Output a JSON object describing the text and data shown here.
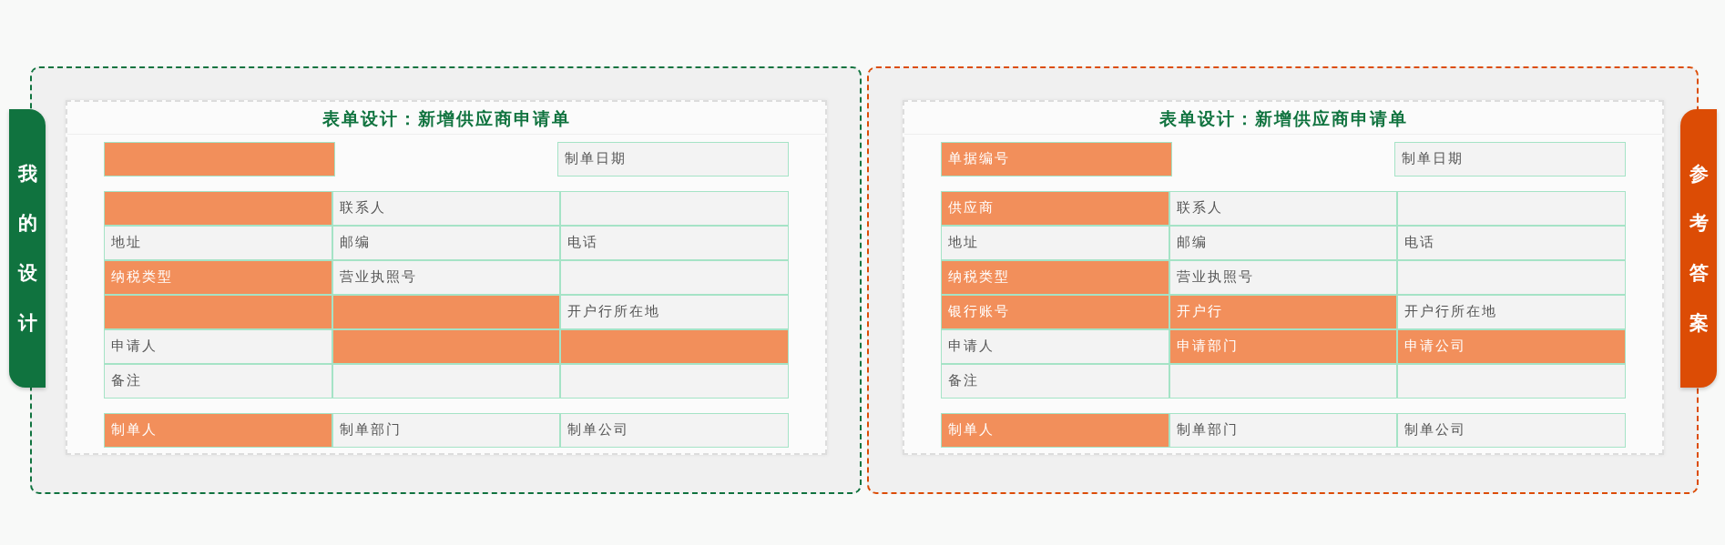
{
  "panels": [
    {
      "tab_label": "我的设计",
      "kind": "left",
      "color": "#10733f",
      "title": "表单设计：新增供应商申请单",
      "header": {
        "left": {
          "highlighted": true
        },
        "right": {
          "text": "制单日期",
          "highlighted": false
        }
      },
      "rows": [
        [
          {
            "highlighted": true
          },
          {
            "text": "联系人",
            "highlighted": false
          },
          {
            "highlighted": false
          }
        ],
        [
          {
            "text": "地址",
            "highlighted": false
          },
          {
            "text": "邮编",
            "highlighted": false
          },
          {
            "text": "电话",
            "highlighted": false
          }
        ],
        [
          {
            "text": "纳税类型",
            "highlighted": true
          },
          {
            "text": "营业执照号",
            "highlighted": false
          },
          {
            "highlighted": false
          }
        ],
        [
          {
            "highlighted": true
          },
          {
            "highlighted": true
          },
          {
            "text": "开户行所在地",
            "highlighted": false
          }
        ],
        [
          {
            "text": "申请人",
            "highlighted": false
          },
          {
            "highlighted": true
          },
          {
            "highlighted": true
          }
        ],
        [
          {
            "text": "备注",
            "highlighted": false
          },
          {
            "highlighted": false
          },
          {
            "highlighted": false
          }
        ]
      ],
      "footer": [
        {
          "text": "制单人",
          "highlighted": true
        },
        {
          "text": "制单部门",
          "highlighted": false
        },
        {
          "text": "制单公司",
          "highlighted": false
        }
      ]
    },
    {
      "tab_label": "参考答案",
      "kind": "right",
      "color": "#dc4c05",
      "title": "表单设计：新增供应商申请单",
      "header": {
        "left": {
          "text": "单据编号",
          "highlighted": true
        },
        "right": {
          "text": "制单日期",
          "highlighted": false
        }
      },
      "rows": [
        [
          {
            "text": "供应商",
            "highlighted": true
          },
          {
            "text": "联系人",
            "highlighted": false
          },
          {
            "highlighted": false
          }
        ],
        [
          {
            "text": "地址",
            "highlighted": false
          },
          {
            "text": "邮编",
            "highlighted": false
          },
          {
            "text": "电话",
            "highlighted": false
          }
        ],
        [
          {
            "text": "纳税类型",
            "highlighted": true
          },
          {
            "text": "营业执照号",
            "highlighted": false
          },
          {
            "highlighted": false
          }
        ],
        [
          {
            "text": "银行账号",
            "highlighted": true
          },
          {
            "text": "开户行",
            "highlighted": true
          },
          {
            "text": "开户行所在地",
            "highlighted": false
          }
        ],
        [
          {
            "text": "申请人",
            "highlighted": false
          },
          {
            "text": "申请部门",
            "highlighted": true
          },
          {
            "text": "申请公司",
            "highlighted": true
          }
        ],
        [
          {
            "text": "备注",
            "highlighted": false
          },
          {
            "highlighted": false
          },
          {
            "highlighted": false
          }
        ]
      ],
      "footer": [
        {
          "text": "制单人",
          "highlighted": true
        },
        {
          "text": "制单部门",
          "highlighted": false
        },
        {
          "text": "制单公司",
          "highlighted": false
        }
      ]
    }
  ]
}
